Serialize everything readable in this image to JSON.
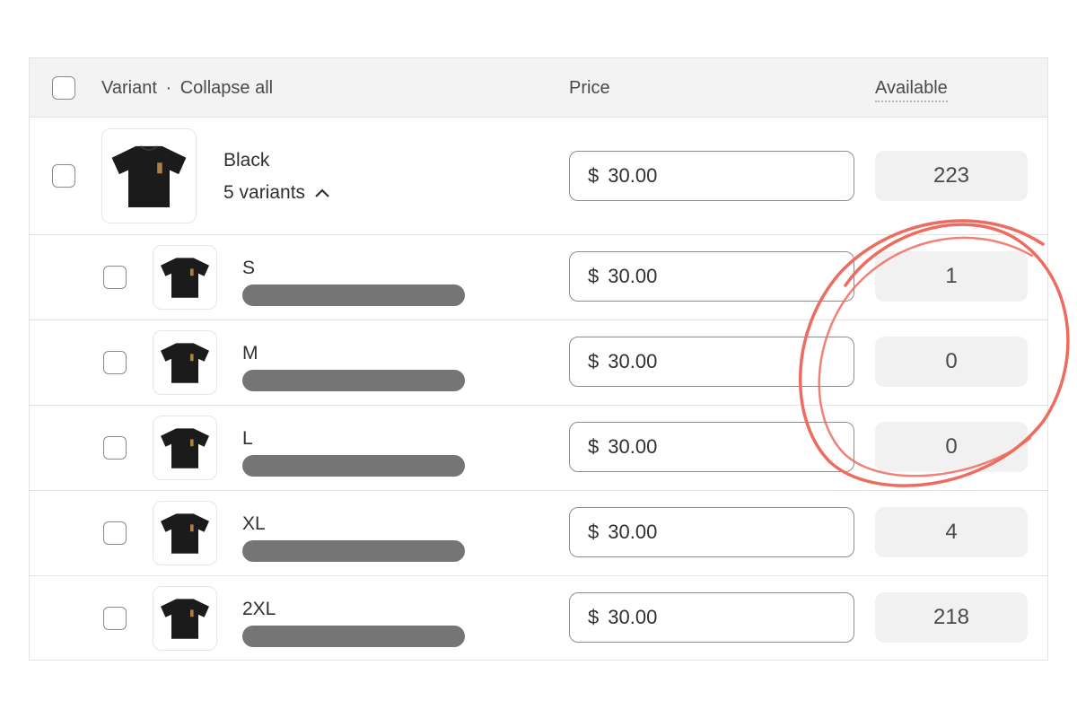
{
  "header": {
    "variant_label": "Variant",
    "separator": "·",
    "collapse_label": "Collapse all",
    "price_label": "Price",
    "available_label": "Available"
  },
  "group": {
    "name": "Black",
    "variants_count": "5 variants",
    "price_currency": "$",
    "price_value": "30.00",
    "available": "223"
  },
  "variants": [
    {
      "name": "S",
      "currency": "$",
      "price": "30.00",
      "available": "1"
    },
    {
      "name": "M",
      "currency": "$",
      "price": "30.00",
      "available": "0"
    },
    {
      "name": "L",
      "currency": "$",
      "price": "30.00",
      "available": "0"
    },
    {
      "name": "XL",
      "currency": "$",
      "price": "30.00",
      "available": "4"
    },
    {
      "name": "2XL",
      "currency": "$",
      "price": "30.00",
      "available": "218"
    }
  ],
  "colors": {
    "annotation_circle": "#ef6b5f",
    "redaction_bar": "#757575",
    "header_bg": "#f3f3f3"
  },
  "icons": [
    "tshirt-icon",
    "chevron-up-icon"
  ]
}
